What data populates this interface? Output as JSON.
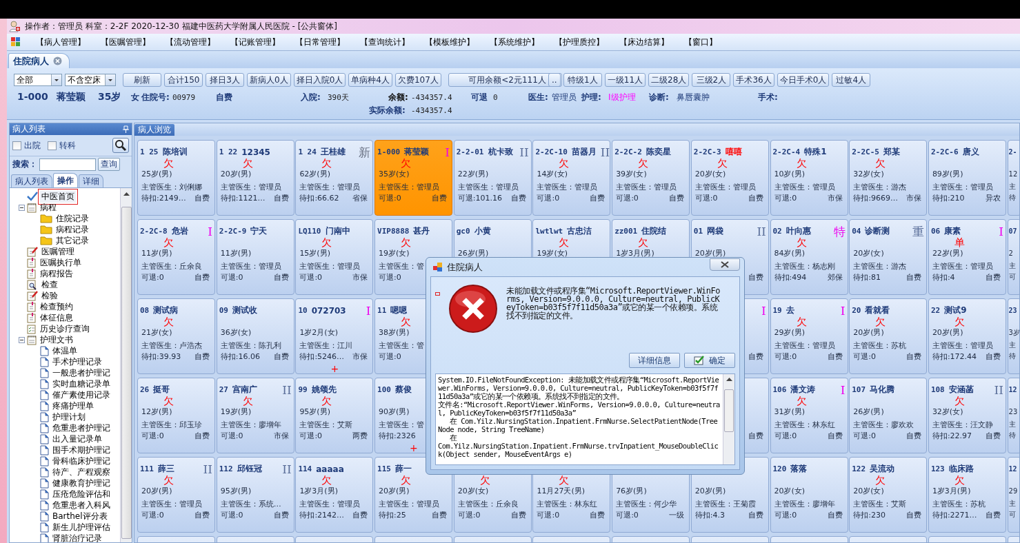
{
  "window": {
    "title": "操作者：管理员  科室：2-2F  2020-12-30  福建中医药大学附属人民医院 - [公共窗体]"
  },
  "menu": [
    "【病人管理】",
    "【医嘱管理】",
    "【流动管理】",
    "【记账管理】",
    "【日常管理】",
    "【查询统计】",
    "【模板维护】",
    "【系统维护】",
    "【护理质控】",
    "【床边结算】",
    "【窗口】"
  ],
  "doc_tabs": [
    {
      "label": "住院病人",
      "selected": true
    }
  ],
  "toolbar": {
    "dropdowns": [
      {
        "value": "全部"
      },
      {
        "value": "不含空床"
      }
    ],
    "buttons": [
      {
        "label": "刷新",
        "kind": "normal"
      },
      {
        "label": "合计150",
        "kind": "normal"
      },
      {
        "label": "择日3人",
        "kind": "normal"
      },
      {
        "label": "新病人0人",
        "kind": "normal"
      },
      {
        "label": "择日入院0人",
        "kind": "normal"
      },
      {
        "label": "单病种4人",
        "kind": "normal"
      },
      {
        "label": "欠费107人",
        "kind": "normal"
      },
      {
        "label": "可用余额<2元111人",
        "kind": "wide"
      },
      {
        "label": "..",
        "kind": "small"
      },
      {
        "label": "特级1人",
        "kind": "normal"
      },
      {
        "label": "一级11人",
        "kind": "normal"
      },
      {
        "label": "二级28人",
        "kind": "normal"
      },
      {
        "label": "三级2人",
        "kind": "normal"
      },
      {
        "label": "手术36人",
        "kind": "normal"
      },
      {
        "label": "今日手术0人",
        "kind": "normal"
      },
      {
        "label": "过敏4人",
        "kind": "normal"
      }
    ]
  },
  "info": {
    "line_1": [
      {
        "text": "1-000",
        "kind": "strong"
      },
      {
        "text": "蒋莹颖",
        "kind": "strong"
      },
      {
        "text": "35岁",
        "kind": "strong"
      },
      {
        "text": "女",
        "kind": "label"
      },
      {
        "text": "住院号:",
        "kind": "label"
      },
      {
        "text": "00979",
        "kind": "value"
      },
      {
        "text": "自费",
        "kind": "label"
      },
      {
        "text": "入院:",
        "kind": "label"
      },
      {
        "text": "390天",
        "kind": "value"
      },
      {
        "text": "余额:",
        "kind": "dark"
      },
      {
        "text": "-434357.4",
        "kind": "value"
      },
      {
        "text": "可退",
        "kind": "label"
      },
      {
        "text": "0",
        "kind": "value"
      },
      {
        "text": "医生:",
        "kind": "label"
      },
      {
        "text": "管理员",
        "kind": "plain"
      },
      {
        "text": "护理:",
        "kind": "label"
      },
      {
        "text": "I级护理",
        "kind": "highlight"
      },
      {
        "text": "诊断:",
        "kind": "label"
      },
      {
        "text": "鼻唇囊肿",
        "kind": "plain"
      },
      {
        "text": "手术:",
        "kind": "label"
      }
    ],
    "line_2": [
      {
        "text": "实际余额:",
        "kind": "label"
      },
      {
        "text": "-434357.4",
        "kind": "value"
      }
    ]
  },
  "sidebar": {
    "title": "病人列表",
    "checkboxes": [
      {
        "label": "出院",
        "checked": false
      },
      {
        "label": "转科",
        "checked": false
      }
    ],
    "search": {
      "label": "搜索：",
      "button": "查询"
    },
    "tabs": [
      {
        "label": "病人列表",
        "selected": false
      },
      {
        "label": "操作",
        "selected": true
      },
      {
        "label": "详细",
        "selected": false
      }
    ],
    "tree": [
      {
        "label": "中医首页",
        "kind": "check",
        "selected": true
      },
      {
        "label": "病程",
        "kind": "book",
        "selected": false,
        "expanded": true,
        "children": [
          {
            "label": "住院记录",
            "kind": "folder",
            "selected": false
          },
          {
            "label": "病程记录",
            "kind": "folder",
            "selected": false
          },
          {
            "label": "其它记录",
            "kind": "folder",
            "selected": false
          }
        ]
      },
      {
        "label": "医嘱管理",
        "kind": "pen",
        "selected": false
      },
      {
        "label": "医嘱执行单",
        "kind": "clip",
        "selected": false
      },
      {
        "label": "病程报告",
        "kind": "clip",
        "selected": false
      },
      {
        "label": "检查",
        "kind": "magnifier",
        "selected": false
      },
      {
        "label": "检验",
        "kind": "pen",
        "selected": false
      },
      {
        "label": "检查预约",
        "kind": "clip",
        "selected": false
      },
      {
        "label": "体征信息",
        "kind": "clip",
        "selected": false
      },
      {
        "label": "历史诊疗查询",
        "kind": "list",
        "selected": false
      },
      {
        "label": "护理文书",
        "kind": "book",
        "selected": false,
        "expanded": true,
        "children": [
          {
            "label": "体温单",
            "kind": "page",
            "selected": false
          },
          {
            "label": "手术护理记录",
            "kind": "page",
            "selected": false
          },
          {
            "label": "一般患者护理记",
            "kind": "page",
            "selected": false
          },
          {
            "label": "实时血糖记录单",
            "kind": "page",
            "selected": false
          },
          {
            "label": "催产素使用记录",
            "kind": "page",
            "selected": false
          },
          {
            "label": "疼痛护理单",
            "kind": "page",
            "selected": false
          },
          {
            "label": "护理计划",
            "kind": "page",
            "selected": false
          },
          {
            "label": "危重患者护理记",
            "kind": "page",
            "selected": false
          },
          {
            "label": "出入量记录单",
            "kind": "page",
            "selected": false
          },
          {
            "label": "围手术期护理记",
            "kind": "page",
            "selected": false
          },
          {
            "label": "骨科临床护理记",
            "kind": "page",
            "selected": false
          },
          {
            "label": "待产、产程观察",
            "kind": "page",
            "selected": false
          },
          {
            "label": "健康教育护理记",
            "kind": "page",
            "selected": false
          },
          {
            "label": "压疮危险评估和",
            "kind": "page",
            "selected": false
          },
          {
            "label": "危重患者入科风",
            "kind": "page",
            "selected": false
          },
          {
            "label": "Barthel评分表",
            "kind": "page",
            "selected": false
          },
          {
            "label": "新生儿护理评估",
            "kind": "page",
            "selected": false
          },
          {
            "label": "肾脏治疗记录",
            "kind": "page",
            "selected": false
          }
        ]
      }
    ]
  },
  "patients": {
    "tab": "病人浏览",
    "rows": [
      {
        "cards": [
          {
            "selected": false,
            "bed": "1  25",
            "name": "陈培训",
            "owe": "欠",
            "age": "25岁(男)",
            "doctor": "主管医生：刘俐娜",
            "balance": "待扣:2149…",
            "payment": "自费"
          },
          {
            "selected": false,
            "bed": "1  22",
            "name": "12345",
            "owe": "欠",
            "age": "20岁(男)",
            "doctor": "主管医生：管理员",
            "balance": "待扣:1121…",
            "payment": "自费"
          },
          {
            "selected": false,
            "bed": "1  24",
            "name": "王桂雄",
            "marker": {
              "text": "新",
              "color": "#6b7385"
            },
            "owe": "欠",
            "age": "62岁(男)",
            "doctor": "主管医生：管理员",
            "balance": "待扣:66.62",
            "payment": "省保"
          },
          {
            "selected": true,
            "bed": "1-000",
            "name": "蒋莹颖",
            "marker": {
              "text": "I",
              "color": "#ee00ee"
            },
            "owe": "欠",
            "age": "35岁(女)",
            "doctor": "主管医生：管理员",
            "balance": "可退:0",
            "payment": "自费"
          },
          {
            "selected": false,
            "bed": "2-2-01",
            "name": "杭卡致",
            "marker": {
              "text": "II",
              "color": "#5b6f9a"
            },
            "age": "22岁(男)",
            "doctor": "主管医生：管理员",
            "balance": "可退:101.16",
            "payment": "自费"
          },
          {
            "selected": false,
            "bed": "2-2C-10",
            "name": "苗器月",
            "marker": {
              "text": "II",
              "color": "#5b6f9a"
            },
            "owe": "欠",
            "age": "14岁(女)",
            "doctor": "主管医生：管理员",
            "balance": "可退:0",
            "payment": "自费"
          },
          {
            "selected": false,
            "bed": "2-2C-2",
            "name": "陈奕星",
            "owe": "欠",
            "age": "39岁(女)",
            "doctor": "主管医生：管理员",
            "balance": "可退:0",
            "payment": "自费"
          },
          {
            "selected": false,
            "bed": "2-2C-3",
            "name": "嘻嘻",
            "alert": true,
            "owe": "欠",
            "age": "20岁(女)",
            "doctor": "主管医生：管理员",
            "balance": "可退:0",
            "payment": "自费"
          },
          {
            "selected": false,
            "bed": "2-2C-4",
            "name": "特殊1",
            "owe": "欠",
            "age": "10岁(男)",
            "doctor": "主管医生：管理员",
            "balance": "可退:0",
            "payment": "市保"
          },
          {
            "selected": false,
            "bed": "2-2C-5",
            "name": "郑某",
            "owe": "欠",
            "age": "32岁(女)",
            "doctor": "主管医生：游杰",
            "balance": "待扣:9669…",
            "payment": "市保"
          },
          {
            "selected": false,
            "bed": "2-2C-6",
            "name": "唐义",
            "age": "89岁(男)",
            "doctor": "主管医生：管理员",
            "balance": "待扣:210",
            "payment": "异农"
          },
          {
            "selected": false,
            "bed": "2-",
            "age": "12",
            "doctor": "主",
            "balance": "待"
          }
        ]
      },
      {
        "cards": [
          {
            "selected": false,
            "bed": "2-2C-8",
            "name": "危岩",
            "marker": {
              "text": "I",
              "color": "#ee00ee"
            },
            "owe": "欠",
            "age": "11岁(男)",
            "doctor": "主管医生：丘余良",
            "balance": "可退:0",
            "payment": "自费"
          },
          {
            "selected": false,
            "bed": "2-2C-9",
            "name": "宁天",
            "age": "11岁(男)",
            "doctor": "主管医生：管理员",
            "balance": "可退:0",
            "payment": "自费"
          },
          {
            "selected": false,
            "bed": "LQ110",
            "name": "门南中",
            "owe": "欠",
            "age": "15岁(男)",
            "doctor": "主管医生：管理员",
            "balance": "可退:0",
            "payment": "市保"
          },
          {
            "selected": false,
            "bed": "VIP8888",
            "name": "甚丹",
            "owe": "欠",
            "age": "19岁(女)",
            "doctor": "主管医生：管",
            "balance": "可退:0"
          },
          {
            "selected": false,
            "bed": "gc0",
            "name": "小黄",
            "age": "26岁(男)"
          },
          {
            "selected": false,
            "bed": "lwtlwt",
            "name": "古忠洁",
            "owe": "欠",
            "age": "19岁(女)"
          },
          {
            "selected": false,
            "bed": "zz001",
            "name": "住院结",
            "owe": "欠",
            "age": "1岁3月(男)"
          },
          {
            "selected": false,
            "bed": "01",
            "name": "网袋",
            "marker": {
              "text": "II",
              "color": "#5b6f9a"
            },
            "age": "20岁(男)",
            "payment": "自费"
          },
          {
            "selected": false,
            "bed": "02",
            "name": "叶向惠",
            "marker": {
              "text": "特",
              "color": "#ee00ee"
            },
            "owe": "欠",
            "age": "84岁(男)",
            "doctor": "主管医生：杨志刚",
            "balance": "待扣:494",
            "payment": "郊保"
          },
          {
            "selected": false,
            "bed": "04",
            "name": "诊断测",
            "marker": {
              "text": "重",
              "color": "#5b6f9a"
            },
            "age": "20岁(女)",
            "doctor": "主管医生：游杰",
            "balance": "待扣:81",
            "payment": "自费"
          },
          {
            "selected": false,
            "bed": "06",
            "name": "康素",
            "marker": {
              "text": "I",
              "color": "#ee00ee"
            },
            "owe": "单",
            "age": "22岁(男)",
            "doctor": "主管医生：管理员",
            "balance": "待扣:4",
            "payment": "自费"
          },
          {
            "selected": false,
            "bed": "07",
            "age": "2",
            "doctor": "主",
            "balance": "可"
          }
        ]
      },
      {
        "cards": [
          {
            "selected": false,
            "bed": "08",
            "name": "测试病",
            "owe": "欠",
            "age": "21岁(女)",
            "doctor": "主管医生：卢浩杰",
            "balance": "待扣:39.93",
            "payment": "自费"
          },
          {
            "selected": false,
            "bed": "09",
            "name": "测试收",
            "age": "36岁(女)",
            "doctor": "主管医生：陈孔利",
            "balance": "待扣:16.06",
            "payment": "自费"
          },
          {
            "selected": false,
            "bed": "10",
            "name": "072703",
            "marker": {
              "text": "I",
              "color": "#ee00ee"
            },
            "age": "1岁2月(女)",
            "doctor": "主管医生：江川",
            "balance": "待扣:5246…",
            "payment": "市保",
            "cross": "+"
          },
          {
            "selected": false,
            "bed": "11",
            "name": "嗯嗯",
            "owe": "欠",
            "age": "38岁(男)",
            "doctor": "主管医生：管",
            "balance": "可退:0"
          },
          {
            "selected": false,
            "marker": {
              "text": "I",
              "color": "#ee00ee"
            },
            "payment": "自费"
          },
          {
            "selected": false,
            "bed": "19",
            "name": "去",
            "marker": {
              "text": "I",
              "color": "#ee00ee"
            },
            "owe": "欠",
            "age": "29岁(男)",
            "doctor": "主管医生：管理员",
            "balance": "可退:0",
            "payment": "自费"
          },
          {
            "selected": false,
            "bed": "20",
            "name": "看就看",
            "owe": "欠",
            "age": "20岁(男)",
            "doctor": "主管医生：苏杭",
            "balance": "可退:0",
            "payment": "自费"
          },
          {
            "selected": false,
            "bed": "22",
            "name": "测试9",
            "owe": "欠",
            "age": "20岁(男)",
            "doctor": "主管医生：管理员",
            "balance": "待扣:172.44",
            "payment": "自费"
          },
          {
            "selected": false,
            "bed": "23",
            "age": "3岁",
            "doctor": "主",
            "balance": "待"
          }
        ]
      },
      {
        "cards": [
          {
            "selected": false,
            "bed": "26",
            "name": "挺哥",
            "owe": "欠",
            "age": "12岁(男)",
            "doctor": "主管医生：邱玉珍",
            "balance": "可退:0",
            "payment": "自费"
          },
          {
            "selected": false,
            "bed": "27",
            "name": "宫南广",
            "marker": {
              "text": "II",
              "color": "#5b6f9a"
            },
            "owe": "欠",
            "age": "19岁(男)",
            "doctor": "主管医生：廖增年",
            "balance": "可退:0",
            "payment": "市保"
          },
          {
            "selected": false,
            "bed": "99",
            "name": "姚颂先",
            "owe": "欠",
            "age": "95岁(男)",
            "doctor": "主管医生：艾斯",
            "balance": "可退:0",
            "payment": "两费"
          },
          {
            "selected": false,
            "bed": "100",
            "name": "蔡俊",
            "age": "90岁(男)",
            "doctor": "主管医生：管",
            "balance": "待扣:2326",
            "cross": "+"
          },
          {
            "selected": false,
            "payment": "自费"
          },
          {
            "selected": false,
            "bed": "106",
            "name": "潘文涛",
            "marker": {
              "text": "I",
              "color": "#ee00ee"
            },
            "owe": "欠",
            "age": "31岁(男)",
            "doctor": "主管医生：林东红",
            "balance": "可退:0",
            "payment": "自费"
          },
          {
            "selected": false,
            "bed": "107",
            "name": "马化腾",
            "age": "26岁(男)",
            "doctor": "主管医生：廖欢欢",
            "balance": "可退:0",
            "payment": "自费"
          },
          {
            "selected": false,
            "bed": "108",
            "name": "安涵菡",
            "marker": {
              "text": "II",
              "color": "#5b6f9a"
            },
            "owe": "欠",
            "age": "32岁(女)",
            "doctor": "主管医生：汪文静",
            "balance": "待扣:22.97",
            "payment": "自费"
          },
          {
            "selected": false,
            "bed": "12",
            "age": "23",
            "doctor": "主",
            "balance": "待"
          }
        ]
      },
      {
        "cards": [
          {
            "selected": false,
            "bed": "111",
            "name": "薛三",
            "marker": {
              "text": "II",
              "color": "#5b6f9a"
            },
            "owe": "欠",
            "age": "20岁(男)",
            "doctor": "主管医生：管理员",
            "balance": "可退:0",
            "payment": "自费"
          },
          {
            "selected": false,
            "bed": "112",
            "name": "邱钰冠",
            "marker": {
              "text": "II",
              "color": "#5b6f9a"
            },
            "age": "95岁(男)",
            "doctor": "主管医生：系统…",
            "balance": "可退:0",
            "payment": "自费"
          },
          {
            "selected": false,
            "bed": "114",
            "name": "aaaaa",
            "owe": "欠",
            "age": "1岁3月(男)",
            "doctor": "主管医生：管理员",
            "balance": "待扣:2142…",
            "payment": "自费"
          },
          {
            "selected": false,
            "bed": "115",
            "name": "薛一",
            "owe": "欠",
            "age": "20岁(男)",
            "doctor": "主管医生：管理员",
            "balance": "待扣:25",
            "payment": "自费"
          },
          {
            "selected": false,
            "owe": "欠",
            "age": "20岁(女)",
            "doctor": "主管医生：丘余良",
            "balance": "可退:0",
            "payment": "自费"
          },
          {
            "selected": false,
            "owe": "欠",
            "age": "11月27天(男)",
            "doctor": "主管医生：林东红",
            "balance": "可退:0",
            "payment": "自费"
          },
          {
            "selected": false,
            "age": "76岁(男)",
            "doctor": "主管医生：何少华",
            "balance": "可退:0",
            "payment": "一级"
          },
          {
            "selected": false,
            "age": "20岁(男)",
            "doctor": "主管医生：王菊霞",
            "balance": "待扣:4.3",
            "payment": "自费"
          },
          {
            "selected": false,
            "bed": "120",
            "name": "落落",
            "age": "20岁(女)",
            "doctor": "主管医生：廖增年",
            "balance": "可退:0",
            "payment": "自费"
          },
          {
            "selected": false,
            "bed": "122",
            "name": "吴流动",
            "owe": "欠",
            "age": "20岁(女)",
            "doctor": "主管医生：艾斯",
            "balance": "待扣:230",
            "payment": "自费"
          },
          {
            "selected": false,
            "bed": "123",
            "name": "临床路",
            "owe": "欠",
            "age": "1岁3月(男)",
            "doctor": "主管医生：苏杭",
            "balance": "待扣:2271…",
            "payment": "自费"
          },
          {
            "selected": false,
            "bed": "12",
            "age": "29",
            "doctor": "主",
            "balance": "可"
          }
        ]
      },
      {
        "cards": [
          {
            "selected": false
          },
          {
            "selected": false
          },
          {
            "selected": false
          },
          {
            "selected": false
          },
          {
            "selected": false
          },
          {
            "selected": false
          },
          {
            "selected": false
          },
          {
            "selected": false
          },
          {
            "selected": false
          },
          {
            "selected": false
          },
          {
            "selected": false
          },
          {
            "selected": false
          }
        ]
      }
    ]
  },
  "dialog": {
    "title": "住院病人",
    "message": "未能加载文件或程序集“Microsoft.ReportViewer.WinForms, Version=9.0.0.0, Culture=neutral, PublicKeyToken=b03f5f7f11d50a3a”或它的某一个依赖项。系统找不到指定的文件。",
    "buttons": [
      {
        "label": "详细信息",
        "kind": "plain"
      },
      {
        "label": "确定",
        "kind": "ok"
      }
    ],
    "details": [
      "System.IO.FileNotFoundException: 未能加载文件或程序集“Microsoft.ReportViewer.WinForms, Version=9.0.0.0, Culture=neutral, PublicKeyToken=b03f5f7f11d50a3a”或它的某一个依赖项。系统找不到指定的文件。",
      "文件名:“Microsoft.ReportViewer.WinForms, Version=9.0.0.0, Culture=neutral, PublicKeyToken=b03f5f7f11d50a3a”",
      "   在 Com.Yilz.NursingStation.Inpatient.FrmNurse.SelectPatientNode(TreeNode node, String TreeName)",
      "   在",
      "Com.Yilz.NursingStation.Inpatient.FrmNurse.trvInpatient_MouseDoubleClick(Object sender, MouseEventArgs e)"
    ]
  }
}
